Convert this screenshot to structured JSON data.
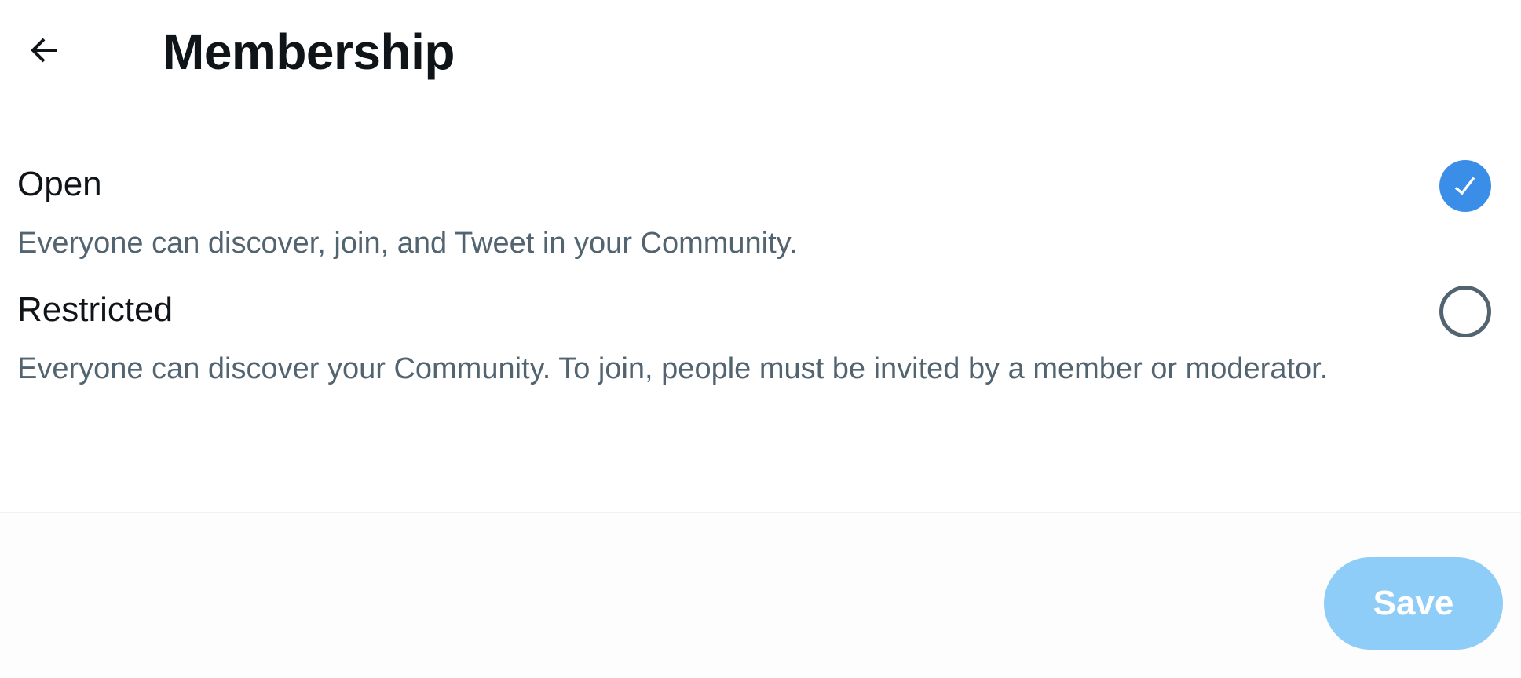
{
  "header": {
    "title": "Membership",
    "back_icon": "arrow-left-icon"
  },
  "options": [
    {
      "label": "Open",
      "description": "Everyone can discover, join, and Tweet in your Community.",
      "selected": true
    },
    {
      "label": "Restricted",
      "description": "Everyone can discover your Community. To join, people must be invited by a member or moderator.",
      "selected": false
    }
  ],
  "footer": {
    "save_label": "Save"
  },
  "colors": {
    "accent": "#3b8ee8",
    "save_disabled": "#8ecdf7",
    "primary_text": "#0f1419",
    "secondary_text": "#536471"
  }
}
